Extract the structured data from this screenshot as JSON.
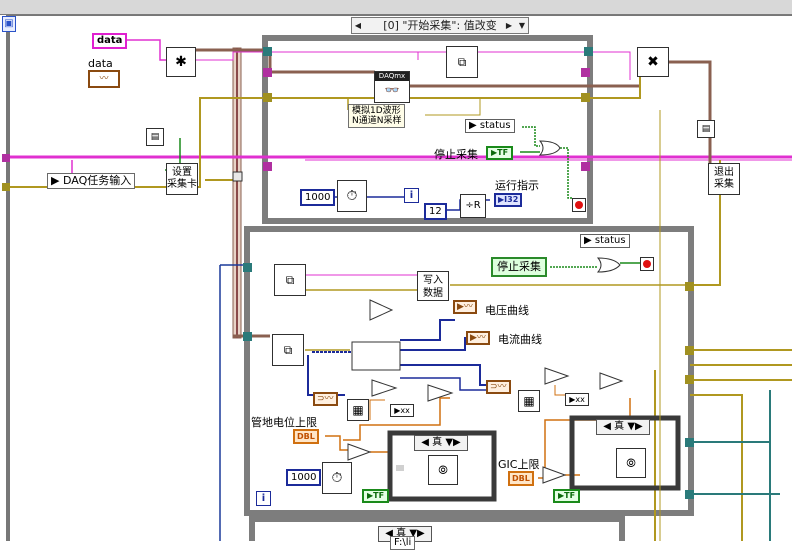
{
  "selector": {
    "label": "[0] \"开始采集\": 值改变"
  },
  "frame": {
    "num_icon": "▣"
  },
  "labels": {
    "data_pink": "data",
    "data_ctrl": "data",
    "daq_input": "DAQ任务输入",
    "setup_daq": "设置\n采集卡",
    "exit_daq": "退出\n采集",
    "stop_top": "停止采集",
    "run_indicator": "运行指示",
    "stop_button": "停止采集",
    "write_data": "写入\n数据",
    "voltage_curve": "电压曲线",
    "current_curve": "电流曲线",
    "pipe_upper": "管地电位上限",
    "gic_upper": "GIC上限",
    "daqmx_node": "DAQmx",
    "poly_text": "模拟1D波形\nN通道N采样"
  },
  "constants": {
    "c1000_top": "1000",
    "c12": "12",
    "c1000_bot": "1000",
    "status_top": "status",
    "status_mid": "status",
    "i32": "I32",
    "tf_top": "TF",
    "tf_mid": "TF",
    "tf_right": "TF",
    "dbl_left": "DBL",
    "dbl_right": "DBL",
    "case_true_left": "真",
    "case_true_right": "真",
    "case_true_bottom": "真",
    "path_text": "F:\\li"
  },
  "colors": {
    "pink_wire": "#e030d0",
    "olive_wire": "#b09820",
    "gray_frame": "#7a7a7a",
    "blue_wire": "#2a3aa0"
  }
}
